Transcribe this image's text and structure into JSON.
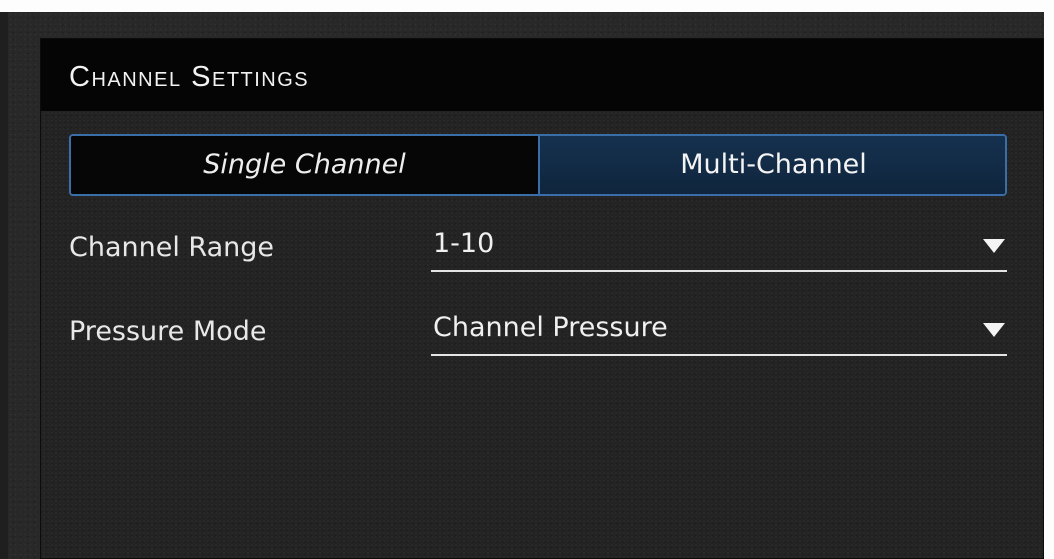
{
  "panel": {
    "title": "Channel Settings"
  },
  "mode_toggle": {
    "options": [
      {
        "label": "Single Channel",
        "selected": false
      },
      {
        "label": "Multi-Channel",
        "selected": true
      }
    ]
  },
  "settings": {
    "channel_range": {
      "label": "Channel Range",
      "value": "1-10"
    },
    "pressure_mode": {
      "label": "Pressure Mode",
      "value": "Channel Pressure"
    }
  },
  "icons": {
    "dropdown": "caret-down-icon"
  },
  "colors": {
    "accent_border": "#3a6ea8",
    "selected_fill": "#13304d",
    "header_bg": "#050505",
    "panel_bg": "#232323"
  }
}
